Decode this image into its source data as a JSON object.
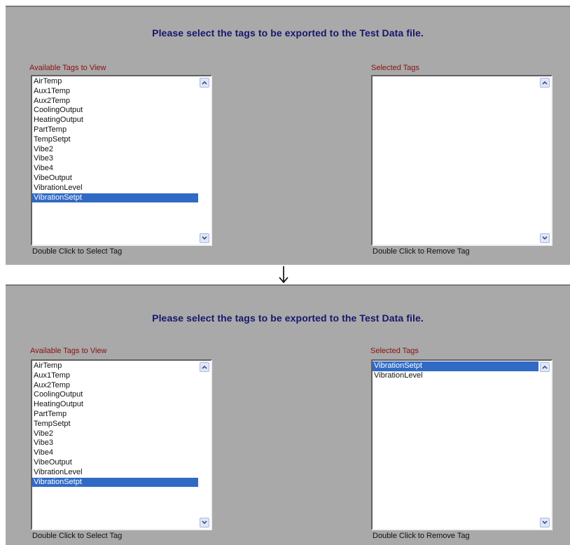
{
  "top": {
    "title": "Please select the tags to be exported to the Test Data file.",
    "available_label": "Available Tags to View",
    "selected_label": "Selected Tags",
    "available_hint": "Double Click to Select Tag",
    "selected_hint": "Double Click to Remove Tag",
    "available_items": [
      "AirTemp",
      "Aux1Temp",
      "Aux2Temp",
      "CoolingOutput",
      "HeatingOutput",
      "PartTemp",
      "TempSetpt",
      "Vibe2",
      "Vibe3",
      "Vibe4",
      "VibeOutput",
      "VibrationLevel",
      "VibrationSetpt"
    ],
    "available_selected": "VibrationSetpt",
    "selected_items": []
  },
  "bottom": {
    "title": "Please select the tags to be exported to the Test Data file.",
    "available_label": "Available Tags to View",
    "selected_label": "Selected Tags",
    "available_hint": "Double Click to Select Tag",
    "selected_hint": "Double Click to Remove Tag",
    "available_items": [
      "AirTemp",
      "Aux1Temp",
      "Aux2Temp",
      "CoolingOutput",
      "HeatingOutput",
      "PartTemp",
      "TempSetpt",
      "Vibe2",
      "Vibe3",
      "Vibe4",
      "VibeOutput",
      "VibrationLevel",
      "VibrationSetpt"
    ],
    "available_selected": "VibrationSetpt",
    "selected_items": [
      "VibrationSetpt",
      "VibrationLevel"
    ],
    "selected_selected": "VibrationSetpt"
  },
  "icons": {
    "scroll_up": "chevron-up-icon",
    "scroll_down": "chevron-down-icon",
    "flow_arrow": "arrow-down-icon"
  },
  "colors": {
    "panel_bg": "#a9a9a9",
    "title": "#16166e",
    "list_label": "#8b1010",
    "selection": "#316ac5"
  }
}
